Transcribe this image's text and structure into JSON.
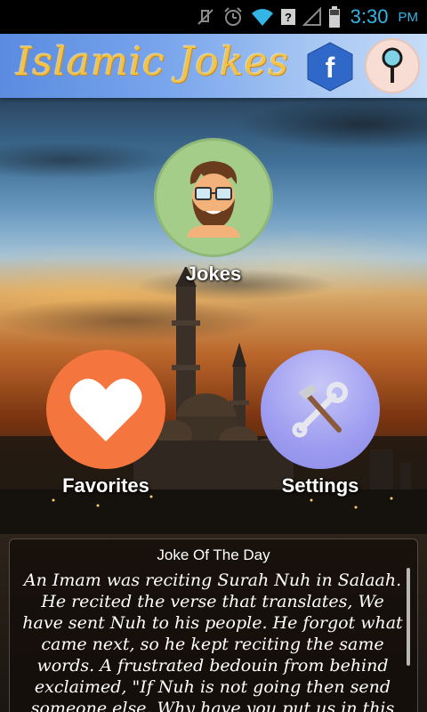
{
  "status_bar": {
    "time": "3:30",
    "ampm": "PM",
    "icons": [
      "mute-icon",
      "alarm-icon",
      "wifi-icon",
      "signal-icon",
      "battery-icon"
    ]
  },
  "header": {
    "title": "Islamic Jokes",
    "facebook_icon": "facebook-icon",
    "search_icon": "search-icon"
  },
  "menu": {
    "jokes_label": "Jokes",
    "favorites_label": "Favorites",
    "settings_label": "Settings",
    "jokes_icon": "bearded-man-icon",
    "favorites_icon": "heart-icon",
    "settings_icon": "tools-icon"
  },
  "joke_of_day": {
    "title": "Joke Of The Day",
    "text": "An Imam was reciting Surah Nuh in Salaah. He recited the verse that translates, We have sent Nuh to his people. He forgot what came next, so he kept reciting the same words. A frustrated bedouin from behind exclaimed, \"If Nuh is not going then send someone else. Why have you put us in this difficulty?\""
  },
  "colors": {
    "header_gradient_start": "#5a8be0",
    "header_gradient_end": "#c6dcf7",
    "title_gold": "#f2c34a",
    "jokes_circle": "#a5cd8a",
    "favorites_circle": "#f4763e",
    "settings_circle": "#9d9cf0",
    "status_accent": "#33b5e5"
  }
}
